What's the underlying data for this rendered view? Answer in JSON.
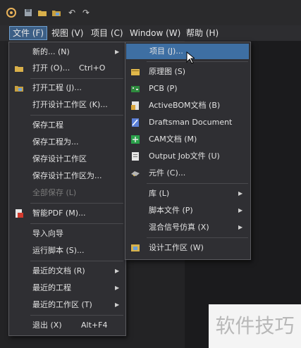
{
  "menubar": {
    "file": "文件 (F)",
    "view": "视图 (V)",
    "project": "项目 (C)",
    "window": "Window (W)",
    "help": "帮助 (H)"
  },
  "file_menu": {
    "new": "新的... (N)",
    "open": "打开 (O)...",
    "open_shortcut": "Ctrl+O",
    "open_project": "打开工程 (J)...",
    "open_workspace": "打开设计工作区 (K)...",
    "save_project": "保存工程",
    "save_project_as": "保存工程为...",
    "save_workspace": "保存设计工作区",
    "save_workspace_as": "保存设计工作区为...",
    "save_all": "全部保存 (L)",
    "smart_pdf": "智能PDF (M)...",
    "import_wizard": "导入向导",
    "run_script": "运行脚本 (S)...",
    "recent_docs": "最近的文档 (R)",
    "recent_projects": "最近的工程",
    "recent_workspaces": "最近的工作区 (T)",
    "exit": "退出 (X)",
    "exit_shortcut": "Alt+F4"
  },
  "new_submenu": {
    "project": "项目 (J)...",
    "schematic": "原理图 (S)",
    "pcb": "PCB (P)",
    "activebom": "ActiveBOM文档 (B)",
    "draftsman": "Draftsman Document",
    "cam": "CAM文档 (M)",
    "output_job": "Output Job文件 (U)",
    "component": "元件 (C)...",
    "library": "库 (L)",
    "script_file": "脚本文件 (P)",
    "mixed_sim": "混合信号仿真 (X)",
    "design_workspace": "设计工作区 (W)"
  },
  "watermark": "软件技巧",
  "colors": {
    "highlight": "#3e6fa3",
    "menu_bg": "#2f2f33"
  }
}
